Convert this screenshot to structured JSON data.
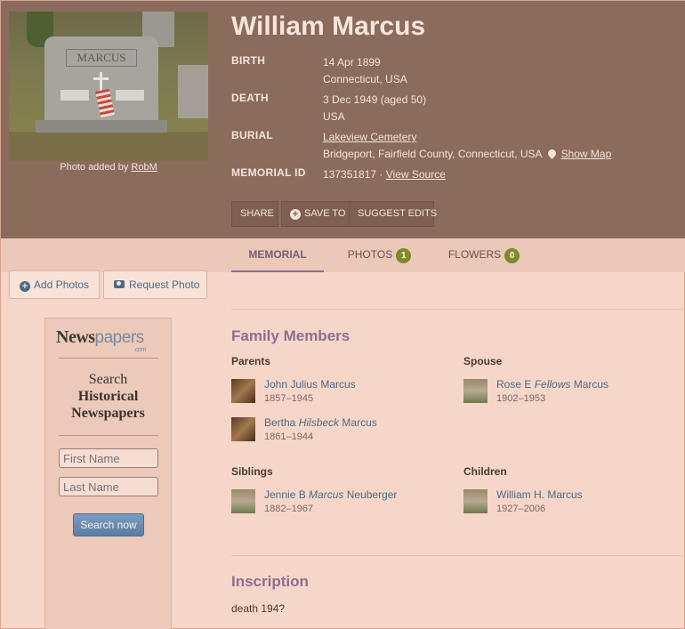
{
  "memorial": {
    "name": "William Marcus",
    "photo_caption_prefix": "Photo added by ",
    "photo_added_by": "RobM",
    "headstone_text": "MARCUS",
    "birth_label": "BIRTH",
    "birth_date": "14 Apr 1899",
    "birth_place": "Connecticut, USA",
    "death_label": "DEATH",
    "death_date": "3 Dec 1949 (aged 50)",
    "death_place": "USA",
    "burial_label": "BURIAL",
    "cemetery": "Lakeview Cemetery",
    "burial_place": "Bridgeport, Fairfield County, Connecticut, USA",
    "show_map": "Show Map",
    "memorial_id_label": "MEMORIAL ID",
    "memorial_id": "137351817",
    "id_separator": " · ",
    "view_source": "View Source"
  },
  "actions": {
    "share": "SHARE",
    "save_to": "SAVE TO",
    "suggest_edits": "SUGGEST EDITS"
  },
  "tabs": {
    "memorial": "MEMORIAL",
    "photos": "PHOTOS",
    "photos_count": "1",
    "flowers": "FLOWERS",
    "flowers_count": "0"
  },
  "side": {
    "add_photos": "Add Photos",
    "request_photo": "Request Photo"
  },
  "ad": {
    "logo_bold": "News",
    "logo_light": "papers",
    "logo_com": ".com",
    "search_line1": "Search",
    "search_line2": "Historical",
    "search_line3": "Newspapers",
    "first_name_placeholder": "First Name",
    "last_name_placeholder": "Last Name",
    "search_button": "Search now"
  },
  "family": {
    "title": "Family Members",
    "parents_label": "Parents",
    "spouse_label": "Spouse",
    "siblings_label": "Siblings",
    "children_label": "Children",
    "parent1_name": "John Julius Marcus",
    "parent1_dates": "1857–1945",
    "parent2_first": "Bertha ",
    "parent2_maiden": "Hilsbeck",
    "parent2_last": " Marcus",
    "parent2_dates": "1861–1944",
    "spouse_first": "Rose E ",
    "spouse_maiden": "Fellows",
    "spouse_last": " Marcus",
    "spouse_dates": "1902–1953",
    "sibling_first": "Jennie B ",
    "sibling_maiden": "Marcus",
    "sibling_last": " Neuberger",
    "sibling_dates": "1882–1967",
    "child_name": "William H. Marcus",
    "child_dates": "1927–2006"
  },
  "inscription": {
    "title": "Inscription",
    "text": "death 194?"
  }
}
